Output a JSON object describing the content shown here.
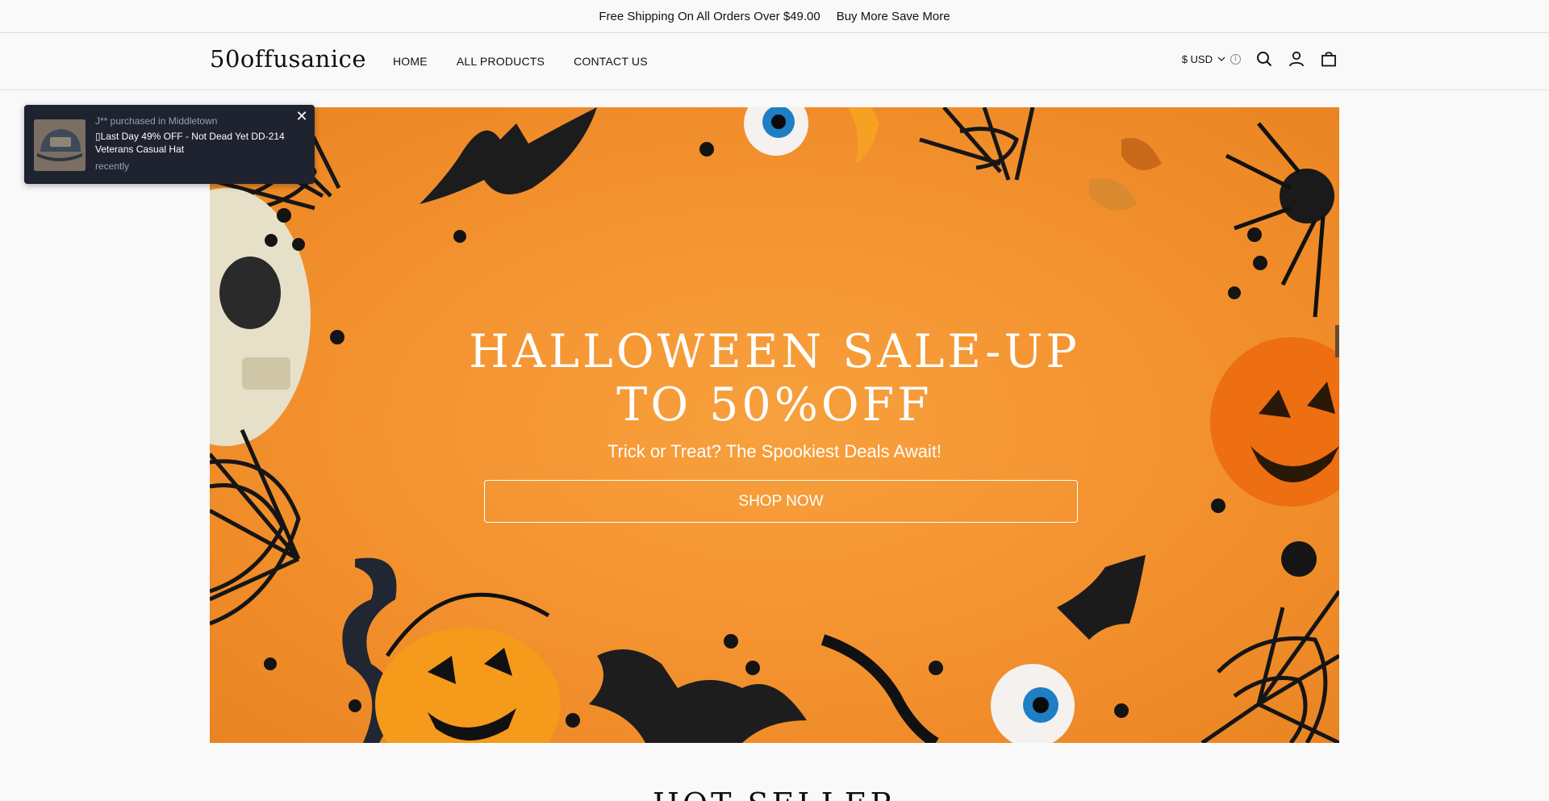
{
  "announcement": {
    "text1": "Free Shipping On All Orders Over $49.00",
    "text2": "Buy More Save More"
  },
  "header": {
    "logo": "50offusanice",
    "nav": [
      "HOME",
      "ALL PRODUCTS",
      "CONTACT US"
    ],
    "currency": "$ USD"
  },
  "icons": [
    "chevron-down-icon",
    "info-icon",
    "search-icon",
    "account-icon",
    "cart-icon",
    "close-icon"
  ],
  "hero": {
    "title_line1": "HALLOWEEN SALE-UP",
    "title_line2": "TO 50%OFF",
    "subtitle": "Trick or Treat? The Spookiest Deals Await!",
    "button": "SHOP NOW"
  },
  "toast": {
    "who": "J** purchased in Middletown",
    "product": "▯Last Day 49% OFF - Not Dead Yet DD-214 Veterans Casual Hat",
    "time": "recently"
  },
  "section": {
    "heading": "HOT SELLER"
  },
  "colors": {
    "hero_bg": "#f49431",
    "toast_bg": "#1f2330",
    "page_bg": "#faf9f9"
  }
}
